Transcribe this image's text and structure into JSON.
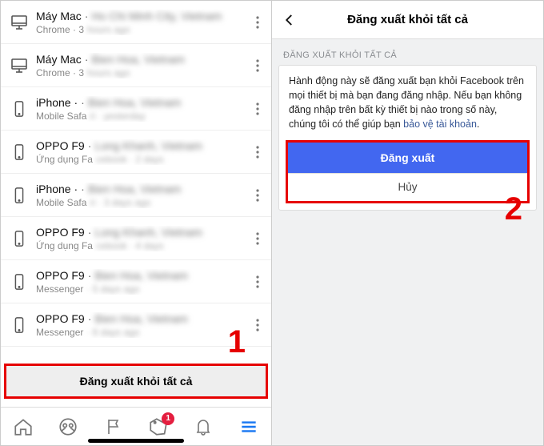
{
  "left": {
    "sessions": [
      {
        "device": "Máy Mac",
        "secondary": "Ho Chi Minh City, Vietnam",
        "app": "Chrome · 3",
        "detail": "hours ago",
        "icon": "desktop"
      },
      {
        "device": "Máy Mac",
        "secondary": "Bien Hoa, Vietnam",
        "app": "Chrome · 3",
        "detail": "hours ago",
        "icon": "desktop"
      },
      {
        "device": "iPhone ·",
        "secondary": "Bien Hoa, Vietnam",
        "app": "Mobile Safa",
        "detail": "ri · yesterday",
        "icon": "phone"
      },
      {
        "device": "OPPO F9",
        "secondary": "Long Khanh, Vietnam",
        "app": "Ứng dụng Fa",
        "detail": "cebook · 2 days",
        "icon": "phone"
      },
      {
        "device": "iPhone ·",
        "secondary": "Bien Hoa, Vietnam",
        "app": "Mobile Safa",
        "detail": "ri · 3 days ago",
        "icon": "phone"
      },
      {
        "device": "OPPO F9",
        "secondary": "Long Khanh, Vietnam",
        "app": "Ứng dụng Fa",
        "detail": "cebook · 4 days",
        "icon": "phone"
      },
      {
        "device": "OPPO F9",
        "secondary": "Bien Hoa, Vietnam",
        "app": "Messenger",
        "detail": "· 5 days ago",
        "icon": "phone"
      },
      {
        "device": "OPPO F9",
        "secondary": "Bien Hoa, Vietnam",
        "app": "Messenger",
        "detail": "· 6 days ago",
        "icon": "phone"
      }
    ],
    "logout_all": "Đăng xuất khỏi tất cả",
    "step_label": "1",
    "tabs": {
      "badge": "1"
    }
  },
  "right": {
    "title": "Đăng xuất khỏi tất cả",
    "section_caption": "ĐĂNG XUẤT KHỎI TẤT CẢ",
    "body_prefix": "Hành động này sẽ đăng xuất bạn khỏi Facebook trên mọi thiết bị mà bạn đang đăng nhập. Nếu bạn không đăng nhập trên bất kỳ thiết bị nào trong số này, chúng tôi có thể giúp bạn ",
    "body_link": "bảo vệ tài khoản",
    "body_suffix": ".",
    "primary": "Đăng xuất",
    "secondary": "Hủy",
    "step_label": "2"
  }
}
